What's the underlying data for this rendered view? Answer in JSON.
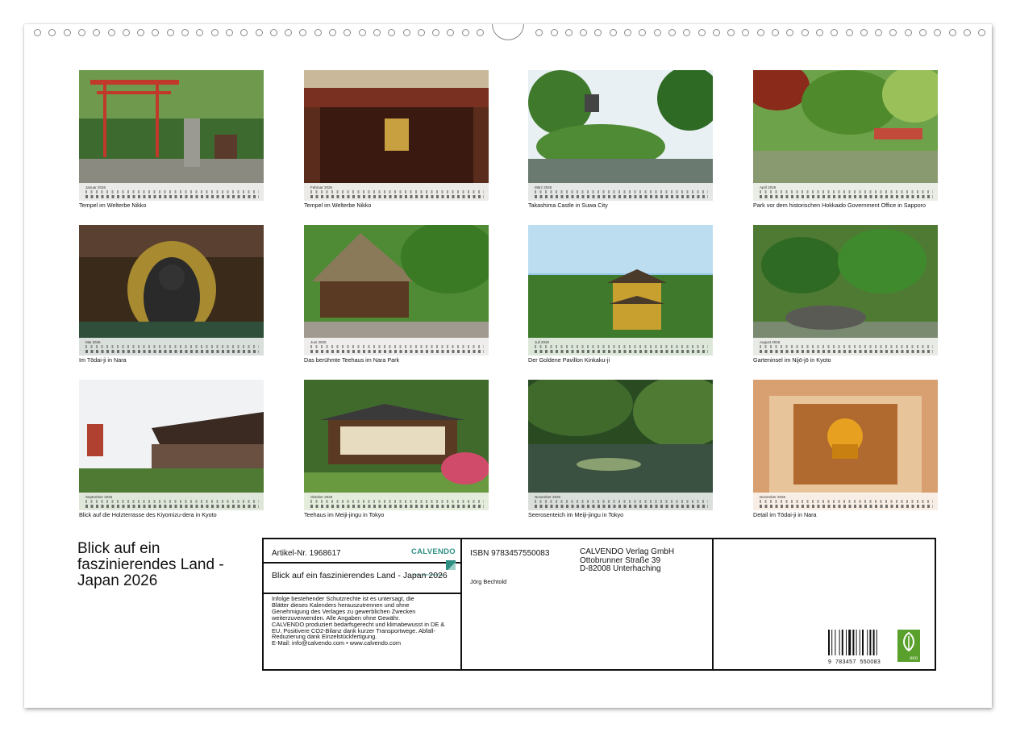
{
  "calendar": {
    "title": "Blick auf ein faszinierendes Land - Japan 2026",
    "months": [
      {
        "name": "Januar 2026",
        "caption": "Tempel im Welterbe Nikko",
        "scene": "torii"
      },
      {
        "name": "Februar 2026",
        "caption": "Tempel im Welterbe Nikko",
        "scene": "shrine"
      },
      {
        "name": "März 2026",
        "caption": "Takashima Castle in Suwa City",
        "scene": "garden"
      },
      {
        "name": "April 2026",
        "caption": "Park vor dem historischen Hokkaido Government Office in Sapporo",
        "scene": "park"
      },
      {
        "name": "Mai 2026",
        "caption": "Im Tōdai-ji in Nara",
        "scene": "buddha"
      },
      {
        "name": "Juni 2026",
        "caption": "Das berühmte Teehaus im Nara Park",
        "scene": "teahouse"
      },
      {
        "name": "Juli 2026",
        "caption": "Der Goldene Pavillon Kinkaku-ji",
        "scene": "pavilion"
      },
      {
        "name": "August 2026",
        "caption": "Garteninsel im Nijō-jō in Kyoto",
        "scene": "island"
      },
      {
        "name": "September 2026",
        "caption": "Blick auf die Holzterrasse des Kiyomizu-dera in Kyoto",
        "scene": "terrace"
      },
      {
        "name": "Oktober 2026",
        "caption": "Teehaus im Meiji-jingu in Tokyo",
        "scene": "meiji"
      },
      {
        "name": "November 2026",
        "caption": "Seerosenteich im Meiji-jingu in Tokyo",
        "scene": "pond"
      },
      {
        "name": "Dezember 2026",
        "caption": "Detail im Tōdai-ji in Nara",
        "scene": "detail"
      }
    ]
  },
  "info": {
    "article": "Artikel-Nr. 1968617",
    "brand": "CALVENDO",
    "brand_tagline": "mein kalenderverlag",
    "product_title": "Blick auf ein faszinierendes Land - Japan 2026",
    "legal_lines": [
      "Infolge bestehender Schutzrechte ist es untersagt, die",
      "Blätter dieses Kalenders herauszutrennen und ohne",
      "Genehmigung des Verlages zu gewerblichen Zwecken",
      "weiterzuverwenden. Alle Angaben ohne Gewähr.",
      "CALVENDO produziert bedarfsgerecht und klimabewusst in DE &",
      "EU. Positivere CO2-Bilanz dank kurzer Transportwege. Abfall-",
      "Reduzierung dank Einzelstückfertigung.",
      "E-Mail: info@calvendo.com • www.calvendo.com"
    ],
    "isbn": "ISBN 9783457550083",
    "author": "Jörg Bechtold",
    "publisher_lines": [
      "CALVENDO Verlag GmbH",
      "Ottobrunner Straße 39",
      "D-82008 Unterhaching"
    ],
    "barcode_digits": [
      "9",
      "783457",
      "550083"
    ],
    "eco_label": "eco"
  },
  "colors": {
    "accent": "#2f8f83",
    "eco": "#5aa02c",
    "border": "#111111"
  }
}
